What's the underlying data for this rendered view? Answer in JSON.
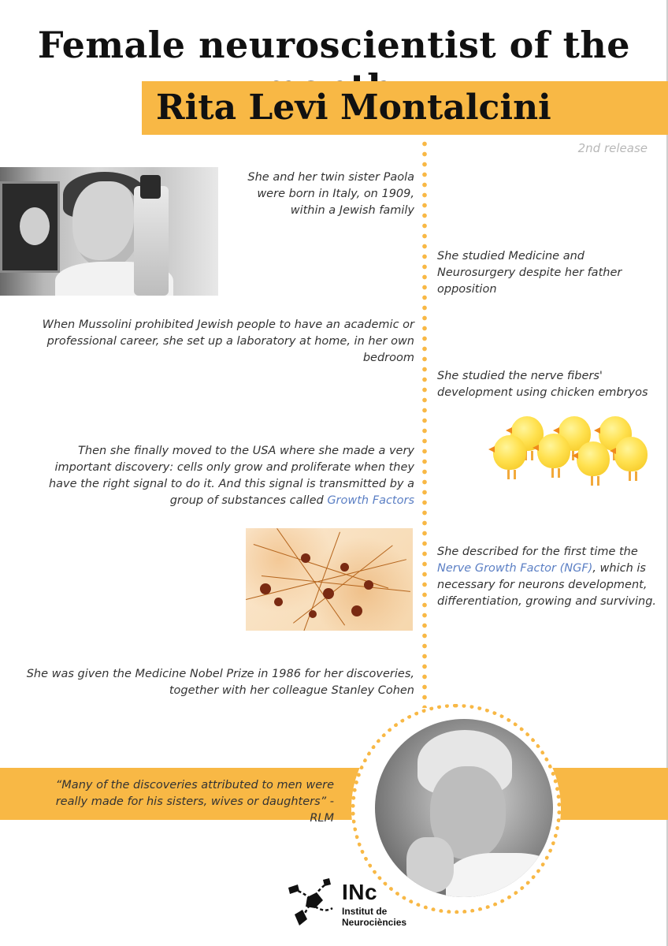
{
  "header": {
    "title": "Female neuroscientist of the month:",
    "name": "Rita Levi Montalcini",
    "release": "2nd release"
  },
  "timeline": {
    "left": [
      {
        "text": "She and her twin sister Paola were born in Italy, on 1909, within a Jewish family"
      },
      {
        "text": "When Mussolini prohibited Jewish people to have an academic or professional career, she set up a laboratory at home, in her own bedroom"
      },
      {
        "text": "Then she finally moved to the USA where she made a very important discovery: cells only grow and proliferate when they have the right signal to do it. And this signal is transmitted by a group of substances called",
        "link": "Growth Factors"
      },
      {
        "text": "She was given the Medicine Nobel Prize in 1986 for her discoveries, together with her colleague Stanley Cohen"
      }
    ],
    "right": [
      {
        "text": "She studied Medicine and Neurosurgery despite her father opposition"
      },
      {
        "text": "She studied the nerve fibers' development using chicken embryos"
      },
      {
        "before": "She described for the first time the",
        "link": "Nerve Growth Factor (NGF)",
        "after": ", which is necessary for neurons development, differentiation, growing and surviving."
      }
    ]
  },
  "quote": {
    "text": "“Many of the discoveries attributed to men were really made for his sisters, wives or daughters” - RLM"
  },
  "logo": {
    "abbr": "INc",
    "line1": "Institut de",
    "line2": "Neurociències"
  },
  "colors": {
    "accent": "#f8b845",
    "link": "#5b7fc4",
    "text": "#333333",
    "release": "#b8b8b8"
  }
}
